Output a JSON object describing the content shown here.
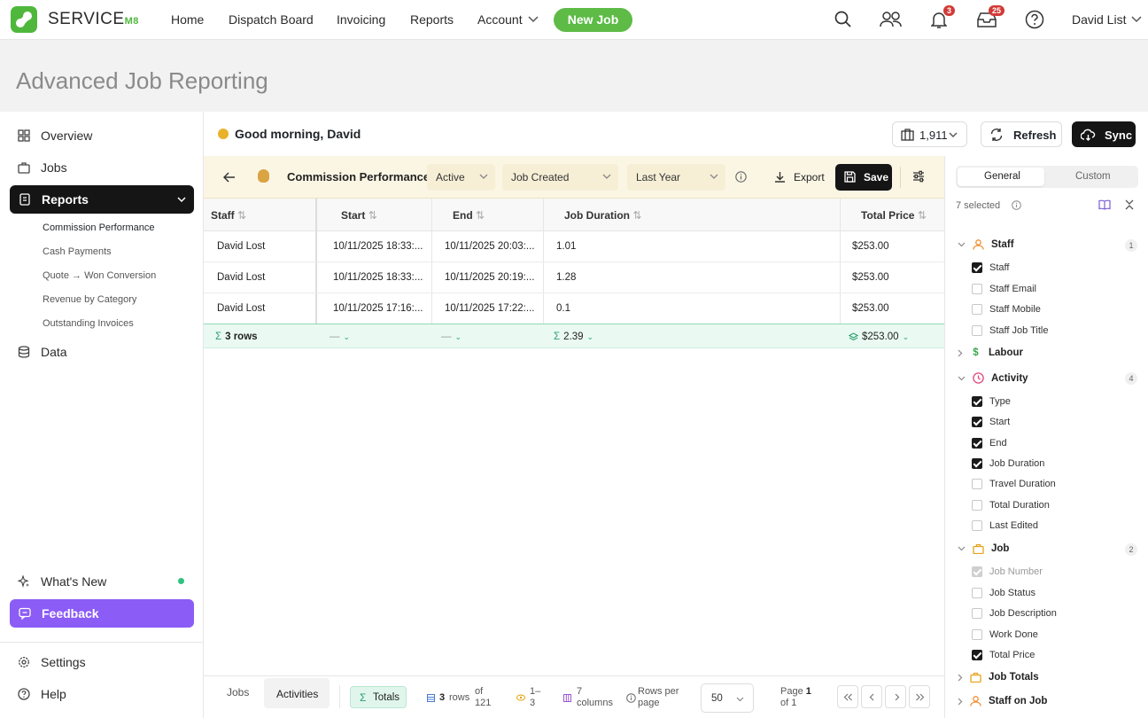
{
  "brand": {
    "name": "SERVICE",
    "suffix": "M8",
    "accent": "#4fb83c"
  },
  "nav": {
    "links": [
      "Home",
      "Dispatch Board",
      "Invoicing",
      "Reports",
      "Account"
    ],
    "new_job": "New Job",
    "notifications_count": "3",
    "inbox_count": "25",
    "user": "David List"
  },
  "page_title": "Advanced Job Reporting",
  "sidebar": {
    "items": [
      {
        "label": "Overview",
        "icon": "grid-icon"
      },
      {
        "label": "Jobs",
        "icon": "briefcase-icon"
      },
      {
        "label": "Reports",
        "icon": "report-icon"
      },
      {
        "label": "Data",
        "icon": "database-icon"
      }
    ],
    "reports_sub": [
      "Commission Performance",
      "Cash Payments",
      "Quote → Won Conversion",
      "Revenue by Category",
      "Outstanding Invoices"
    ],
    "whats_new": "What's New",
    "feedback": "Feedback",
    "settings": "Settings",
    "help": "Help"
  },
  "header": {
    "greeting": "Good morning, David",
    "job_count": "1,911",
    "refresh": "Refresh",
    "sync": "Sync"
  },
  "toolbar": {
    "report_name": "Commission Performance",
    "status": "Active",
    "date_field": "Job Created",
    "range": "Last Year",
    "export": "Export",
    "save": "Save"
  },
  "table": {
    "columns": [
      "Staff",
      "Start",
      "End",
      "Job Duration",
      "Total Price"
    ],
    "rows": [
      [
        "David Lost",
        "10/11/2025 18:33:...",
        "10/11/2025 20:03:...",
        "1.01",
        "$253.00"
      ],
      [
        "David Lost",
        "10/11/2025 18:33:...",
        "10/11/2025 20:19:...",
        "1.28",
        "$253.00"
      ],
      [
        "David Lost",
        "10/11/2025 17:16:...",
        "10/11/2025 17:22:...",
        "0.1",
        "$253.00"
      ]
    ],
    "totals": {
      "rows": "3 rows",
      "start": "—",
      "end": "—",
      "duration": "2.39",
      "price": "$253.00"
    }
  },
  "footer": {
    "tabs": [
      "Jobs",
      "Activities"
    ],
    "totals": "Totals",
    "rows_num": "3",
    "rows_label": "rows",
    "of_total": "of 121",
    "range": "1– 3",
    "columns": "7 columns",
    "rows_per_page_label": "Rows per page",
    "rows_per_page": "50",
    "page_label": "Page",
    "page": "1",
    "page_of": "of 1"
  },
  "panel": {
    "tabs": [
      "General",
      "Custom"
    ],
    "selected": "7 selected",
    "groups": [
      {
        "name": "Staff",
        "count": "1",
        "color": "#f08c2e",
        "expanded": true,
        "fields": [
          {
            "label": "Staff",
            "state": "on"
          },
          {
            "label": "Staff Email",
            "state": "off"
          },
          {
            "label": "Staff Mobile",
            "state": "off"
          },
          {
            "label": "Staff Job Title",
            "state": "off"
          }
        ]
      },
      {
        "name": "Labour",
        "count": "",
        "color": "#3aa64b",
        "expanded": false,
        "fields": []
      },
      {
        "name": "Activity",
        "count": "4",
        "color": "#e0457b",
        "expanded": true,
        "fields": [
          {
            "label": "Type",
            "state": "on"
          },
          {
            "label": "Start",
            "state": "on"
          },
          {
            "label": "End",
            "state": "on"
          },
          {
            "label": "Job Duration",
            "state": "on"
          },
          {
            "label": "Travel Duration",
            "state": "off"
          },
          {
            "label": "Total Duration",
            "state": "off"
          },
          {
            "label": "Last Edited",
            "state": "off"
          }
        ]
      },
      {
        "name": "Job",
        "count": "2",
        "color": "#e8a21c",
        "expanded": true,
        "fields": [
          {
            "label": "Job Number",
            "state": "disabled"
          },
          {
            "label": "Job Status",
            "state": "off"
          },
          {
            "label": "Job Description",
            "state": "off"
          },
          {
            "label": "Work Done",
            "state": "off"
          },
          {
            "label": "Total Price",
            "state": "on"
          }
        ]
      },
      {
        "name": "Job Totals",
        "count": "",
        "color": "#e8a21c",
        "expanded": false,
        "fields": []
      },
      {
        "name": "Staff on Job",
        "count": "",
        "color": "#f08c2e",
        "expanded": false,
        "fields": []
      }
    ]
  }
}
